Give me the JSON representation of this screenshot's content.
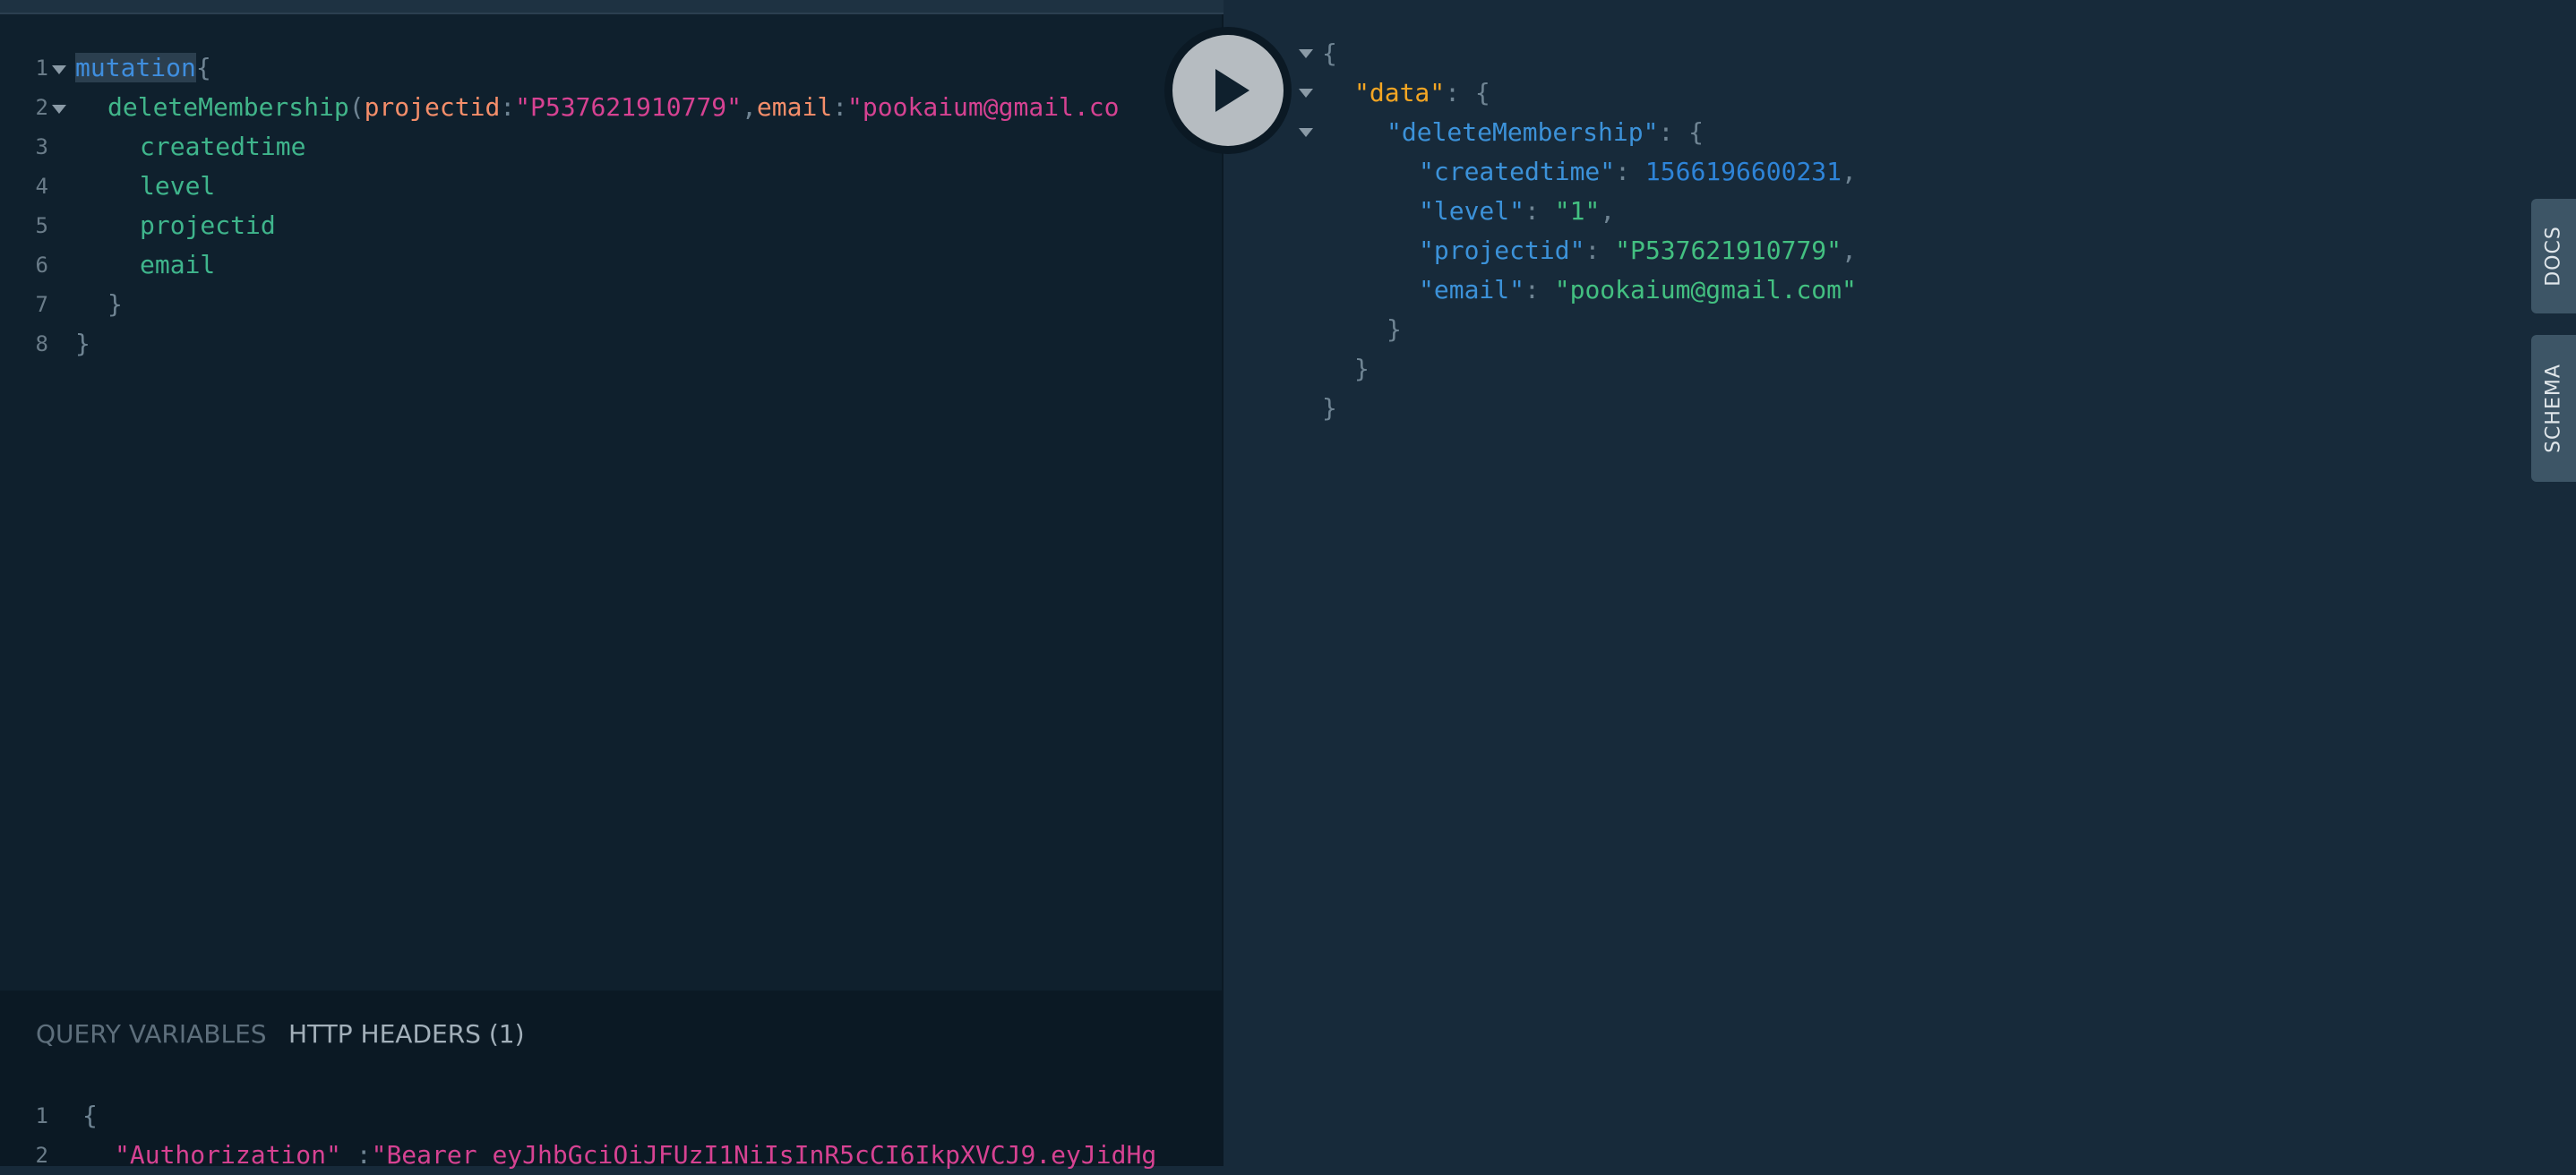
{
  "editor": {
    "line_numbers": [
      "1",
      "2",
      "3",
      "4",
      "5",
      "6",
      "7",
      "8"
    ],
    "line1": {
      "keyword": "mutation",
      "brace": "{"
    },
    "line2": {
      "fn": "deleteMembership",
      "paren": "(",
      "arg1": "projectid",
      "colon1": ":",
      "val1": "\"P537621910779\"",
      "comma": ",",
      "arg2": "email",
      "colon2": ":",
      "val2": "\"pookaium@gmail.co"
    },
    "fields": [
      "createdtime",
      "level",
      "projectid",
      "email"
    ],
    "close_inner": "}",
    "close_outer": "}"
  },
  "run_button": {
    "label": "Execute query"
  },
  "bottom_panel": {
    "tabs": [
      "QUERY VARIABLES",
      "HTTP HEADERS (1)"
    ],
    "line_numbers": [
      "1",
      "2"
    ],
    "line1": "{",
    "line2_key": "\"Authorization\"",
    "line2_sep": " :",
    "line2_val": "\"Bearer eyJhbGciOiJFUzI1NiIsInR5cCI6IkpXVCJ9.eyJidHg"
  },
  "result": {
    "open": "{",
    "data_key": "\"data\"",
    "colon": ": ",
    "brace_open": "{",
    "dm_key": "\"deleteMembership\"",
    "rows": [
      {
        "key": "\"createdtime\"",
        "value": "1566196600231",
        "type": "num",
        "comma": ","
      },
      {
        "key": "\"level\"",
        "value": "\"1\"",
        "type": "str",
        "comma": ","
      },
      {
        "key": "\"projectid\"",
        "value": "\"P537621910779\"",
        "type": "str",
        "comma": ","
      },
      {
        "key": "\"email\"",
        "value": "\"pookaium@gmail.com\"",
        "type": "str",
        "comma": ""
      }
    ],
    "close1": "}",
    "close2": "}",
    "close3": "}"
  },
  "side_tabs": {
    "docs": "DOCS",
    "schema": "SCHEMA"
  }
}
